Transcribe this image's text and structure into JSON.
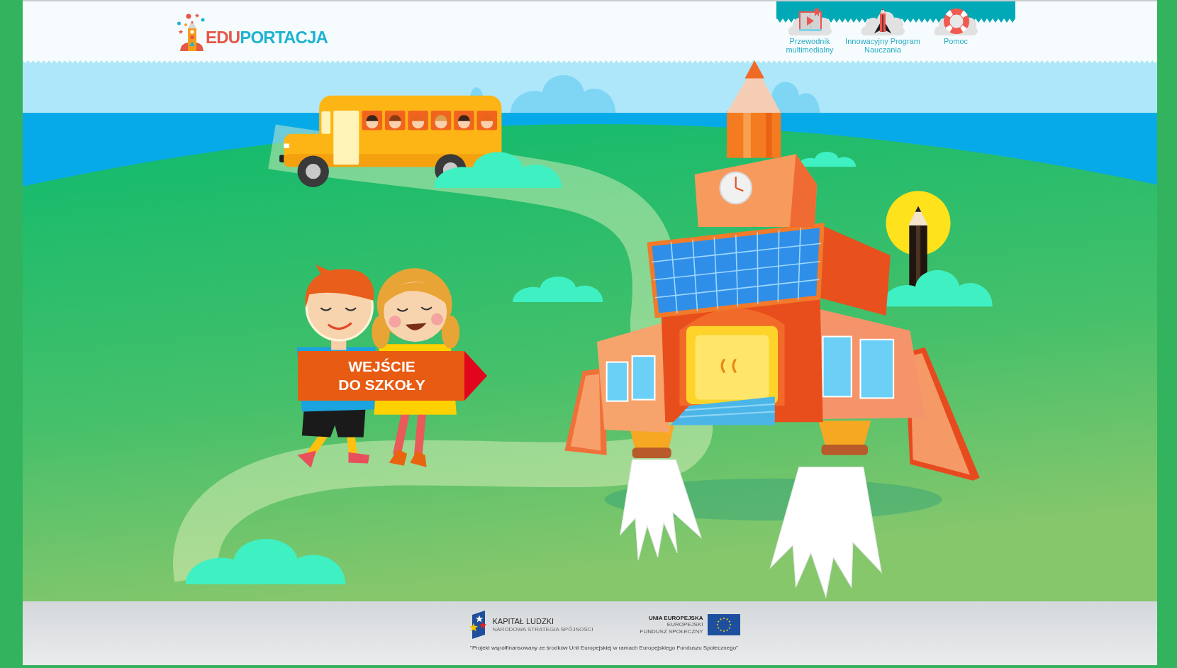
{
  "logo": {
    "parts": [
      {
        "text": "EDU",
        "color": "#e4574a"
      },
      {
        "text": "PORTACJA",
        "color": "#1db3cf"
      }
    ]
  },
  "nav": [
    {
      "kind": "guide",
      "lines": [
        "Przewodnik",
        "multimedialny"
      ]
    },
    {
      "kind": "program",
      "lines": [
        "Innowacyjny Program",
        "Nauczania"
      ]
    },
    {
      "kind": "help",
      "lines": [
        "Pomoc"
      ]
    }
  ],
  "entrance_sign": {
    "lines": [
      "WEJŚCIE",
      "DO SZKOŁY"
    ]
  },
  "footer": {
    "logos": [
      {
        "kind": "kapital_ludzki",
        "title": "KAPITAŁ LUDZKI",
        "lines": [
          "NARODOWA STRATEGIA SPÓJNOŚCI"
        ]
      },
      {
        "kind": "eu",
        "title": "UNIA EUROPEJSKA",
        "lines": [
          "EUROPEJSKI",
          "FUNDUSZ SPOŁECZNY"
        ]
      }
    ],
    "note": "\"Projekt współfinansowany ze środków Unii Europejskiej w ramach Europejskiego Funduszu Społecznego\""
  }
}
